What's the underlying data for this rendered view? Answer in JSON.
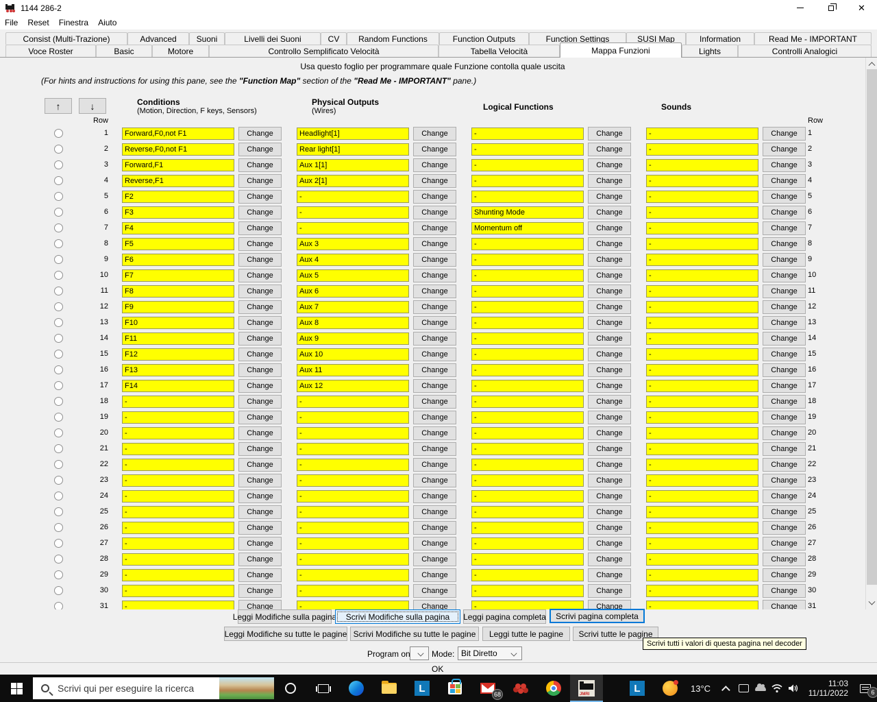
{
  "window": {
    "title": "1144 286-2",
    "menus": [
      "File",
      "Reset",
      "Finestra",
      "Aiuto"
    ]
  },
  "tabs": {
    "row1": [
      "Consist (Multi-Trazione)",
      "Advanced",
      "Suoni",
      "Livelli dei Suoni",
      "CV",
      "Random Functions",
      "Function Outputs",
      "Function Settings",
      "SUSI Map",
      "Information",
      "Read Me - IMPORTANT"
    ],
    "row2": [
      "Voce Roster",
      "Basic",
      "Motore",
      "Controllo Semplificato Velocità",
      "Tabella Velocità",
      "Mappa Funzioni",
      "Lights",
      "Controlli Analogici"
    ],
    "selected": "Mappa Funzioni"
  },
  "pane": {
    "instruction": "Usa questo foglio per programmare quale Funzione contolla quale uscita",
    "hint": {
      "p1": "(For hints and instructions for using this pane, see the ",
      "p2": "\"Function Map\"",
      "p3": " section of the ",
      "p4": "\"Read Me - IMPORTANT\"",
      "p5": " pane.)"
    },
    "move_up_glyph": "↑",
    "move_down_glyph": "↓",
    "row_label": "Row",
    "change_label": "Change",
    "columns": {
      "conditions": "Conditions",
      "conditions_sub": "(Motion, Direction, F keys, Sensors)",
      "outputs": "Physical Outputs",
      "outputs_sub": "(Wires)",
      "logical": "Logical Functions",
      "sounds": "Sounds"
    },
    "rows": [
      {
        "n": "1",
        "cond": "Forward,F0,not F1",
        "out": "Headlight[1]",
        "log": "-",
        "snd": "-"
      },
      {
        "n": "2",
        "cond": "Reverse,F0,not F1",
        "out": "Rear light[1]",
        "log": "-",
        "snd": "-"
      },
      {
        "n": "3",
        "cond": "Forward,F1",
        "out": "Aux 1[1]",
        "log": "-",
        "snd": "-"
      },
      {
        "n": "4",
        "cond": "Reverse,F1",
        "out": "Aux 2[1]",
        "log": "-",
        "snd": "-"
      },
      {
        "n": "5",
        "cond": "F2",
        "out": "-",
        "log": "-",
        "snd": "-"
      },
      {
        "n": "6",
        "cond": "F3",
        "out": "-",
        "log": "Shunting Mode",
        "snd": "-"
      },
      {
        "n": "7",
        "cond": "F4",
        "out": "-",
        "log": "Momentum off",
        "snd": "-"
      },
      {
        "n": "8",
        "cond": "F5",
        "out": "Aux 3",
        "log": "-",
        "snd": "-"
      },
      {
        "n": "9",
        "cond": "F6",
        "out": "Aux 4",
        "log": "-",
        "snd": "-"
      },
      {
        "n": "10",
        "cond": "F7",
        "out": "Aux 5",
        "log": "-",
        "snd": "-"
      },
      {
        "n": "11",
        "cond": "F8",
        "out": "Aux 6",
        "log": "-",
        "snd": "-"
      },
      {
        "n": "12",
        "cond": "F9",
        "out": "Aux 7",
        "log": "-",
        "snd": "-"
      },
      {
        "n": "13",
        "cond": "F10",
        "out": "Aux 8",
        "log": "-",
        "snd": "-"
      },
      {
        "n": "14",
        "cond": "F11",
        "out": "Aux 9",
        "log": "-",
        "snd": "-"
      },
      {
        "n": "15",
        "cond": "F12",
        "out": "Aux 10",
        "log": "-",
        "snd": "-"
      },
      {
        "n": "16",
        "cond": "F13",
        "out": "Aux 11",
        "log": "-",
        "snd": "-"
      },
      {
        "n": "17",
        "cond": "F14",
        "out": "Aux 12",
        "log": "-",
        "snd": "-"
      },
      {
        "n": "18",
        "cond": "-",
        "out": "-",
        "log": "-",
        "snd": "-"
      },
      {
        "n": "19",
        "cond": "-",
        "out": "-",
        "log": "-",
        "snd": "-"
      },
      {
        "n": "20",
        "cond": "-",
        "out": "-",
        "log": "-",
        "snd": "-"
      },
      {
        "n": "21",
        "cond": "-",
        "out": "-",
        "log": "-",
        "snd": "-"
      },
      {
        "n": "22",
        "cond": "-",
        "out": "-",
        "log": "-",
        "snd": "-"
      },
      {
        "n": "23",
        "cond": "-",
        "out": "-",
        "log": "-",
        "snd": "-"
      },
      {
        "n": "24",
        "cond": "-",
        "out": "-",
        "log": "-",
        "snd": "-"
      },
      {
        "n": "25",
        "cond": "-",
        "out": "-",
        "log": "-",
        "snd": "-"
      },
      {
        "n": "26",
        "cond": "-",
        "out": "-",
        "log": "-",
        "snd": "-"
      },
      {
        "n": "27",
        "cond": "-",
        "out": "-",
        "log": "-",
        "snd": "-"
      },
      {
        "n": "28",
        "cond": "-",
        "out": "-",
        "log": "-",
        "snd": "-"
      },
      {
        "n": "29",
        "cond": "-",
        "out": "-",
        "log": "-",
        "snd": "-"
      },
      {
        "n": "30",
        "cond": "-",
        "out": "-",
        "log": "-",
        "snd": "-"
      },
      {
        "n": "31",
        "cond": "-",
        "out": "-",
        "log": "-",
        "snd": "-"
      }
    ],
    "field_color": "#ffff00"
  },
  "bottom": {
    "page_buttons": {
      "read_changes": "Leggi Modifiche sulla pagina",
      "write_changes": "Scrivi Modifiche sulla pagina",
      "read_full": "Leggi pagina completa",
      "write_full": "Scrivi pagina completa"
    },
    "sheet_buttons": {
      "read_changes_all": "Leggi Modifiche su tutte le pagine",
      "write_changes_all": "Scrivi Modifiche su tutte le pagine",
      "read_all": "Leggi tutte le pagine",
      "write_all": "Scrivi tutte le pagine"
    },
    "tooltip": "Scrivi tutti i valori di questa pagina nel decoder",
    "program_on_label": "Program on:",
    "mode_label": "Mode:",
    "mode_value": "Bit Diretto",
    "ok_label": "OK"
  },
  "taskbar": {
    "search_placeholder": "Scrivi qui per eseguire la ricerca",
    "mail_badge": "68",
    "weather_temp": "13°C",
    "time": "11:03",
    "date": "11/11/2022",
    "notification_count": "6",
    "accent_color": "#0078d7"
  }
}
